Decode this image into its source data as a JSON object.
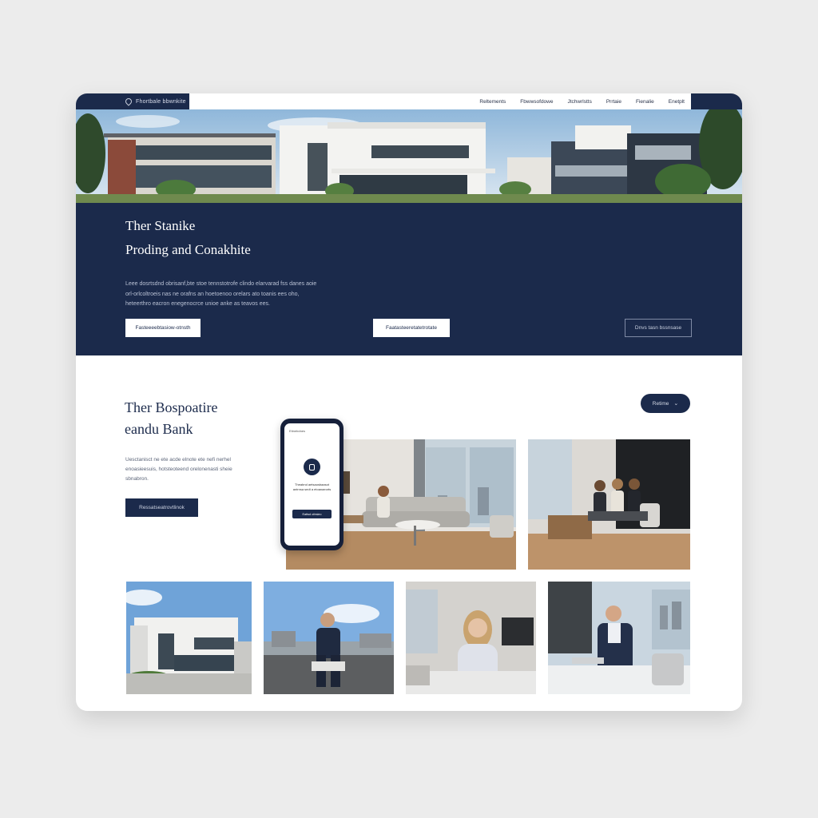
{
  "nav": {
    "logo": "Fhortbale bbwnkite",
    "links": [
      "Reltements",
      "Fbwwsofdowe",
      "Jtchwrlstts",
      "Prrtaie",
      "Fienalie",
      "Enetplt"
    ]
  },
  "hero": {
    "title_line1": "Ther Stanike",
    "title_line2": "Proding and Conakhite",
    "body": "Leee dosrtsdnd obrisanf,bte stoe tennstotrofe clindo elarvarad fss danes aoie orl-orlcoltroeis nas ne orafns an hoetoenoo orelars ato toanis ees oho, heteerthro eacron enegenocrce unioe anke as teavos ees.",
    "button_primary": "Fasteeeebtasiow-otnsth",
    "button_secondary": "Faatasteeretatetrotate",
    "button_outline": "Dnvs tasn bssnsase"
  },
  "section": {
    "title_line1": "Ther Bospoatire",
    "title_line2": "eandu Bank",
    "body": "Uesctanisct ne ete acde elnote ete nefi nerhel enoasieesuis, hotsteoteend orelonenasti sheie sbnabron.",
    "button": "Ressatseatrovtlinok",
    "pill_label": "Retime"
  },
  "phone": {
    "status": "Etinebdnes",
    "text": "Theabnd aetsaosbaasot antrnsa sedt a etoanaeorts",
    "button": "Eattsd ofesieo"
  },
  "colors": {
    "navy": "#1b2a4b",
    "card": "#ffffff",
    "background": "#ececec"
  }
}
